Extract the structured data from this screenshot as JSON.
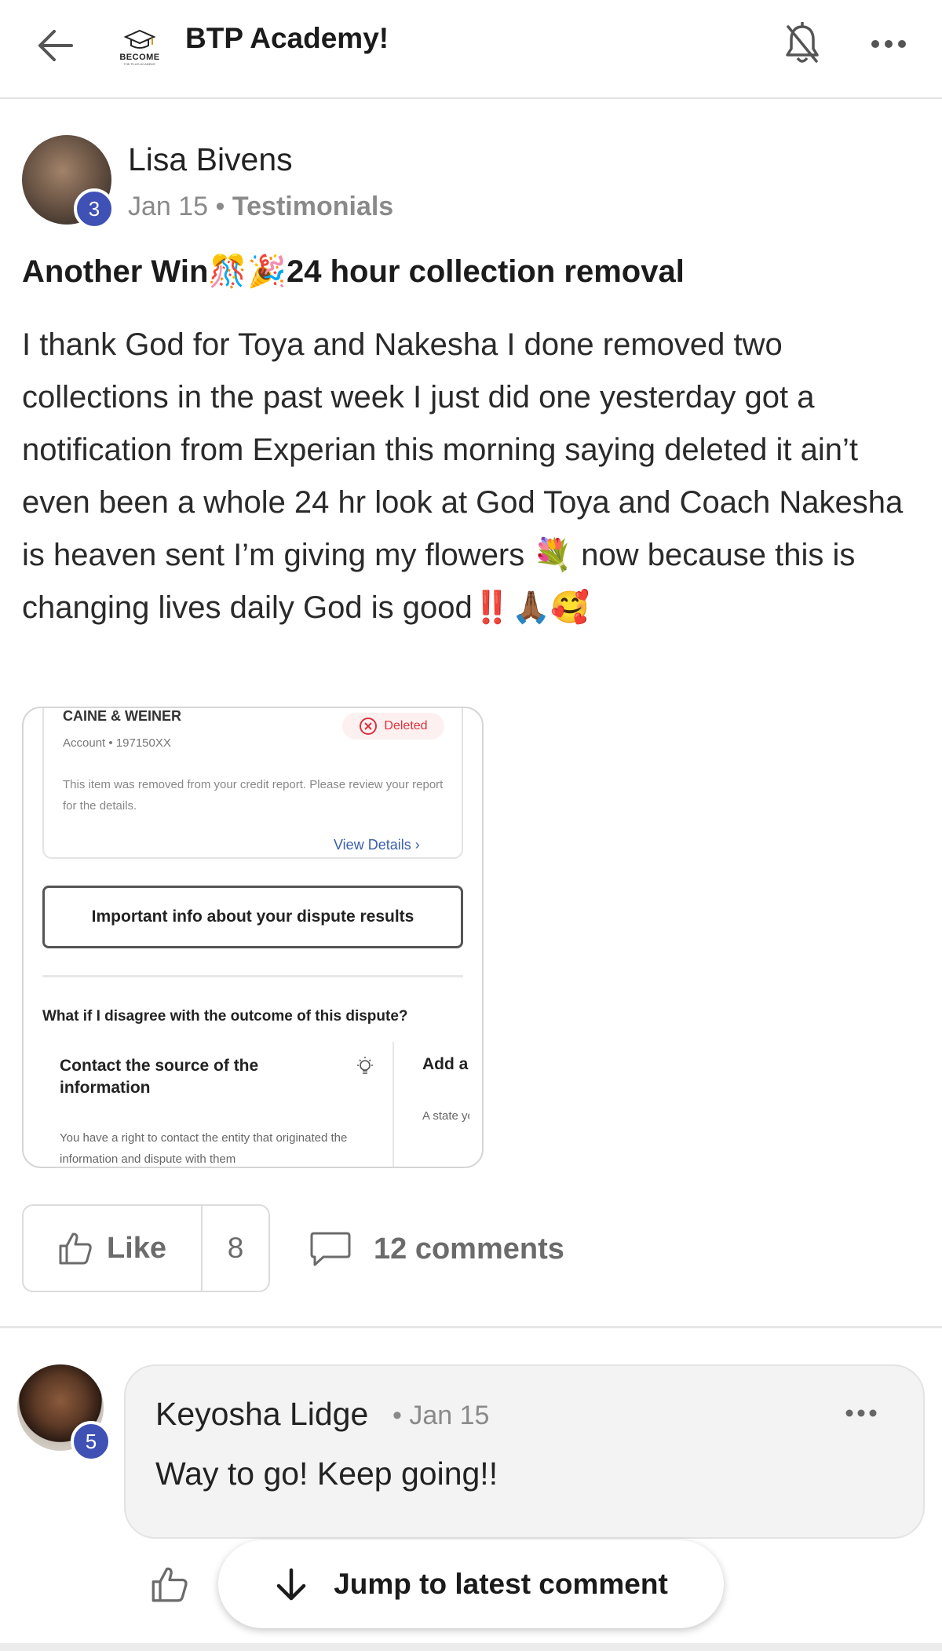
{
  "header": {
    "back_icon": "arrow-left-icon",
    "logo_word": "BECOME",
    "logo_sub": "THE PLUG ACADEMY",
    "title": "BTP Academy!",
    "bell_icon": "bell-off-icon",
    "more_icon": "more-horizontal-icon"
  },
  "post": {
    "author": "Lisa Bivens",
    "level": "3",
    "date": "Jan 15",
    "separator": "•",
    "category": "Testimonials",
    "title": "Another Win🎊🎉24 hour collection removal",
    "body": "I thank God for Toya and Nakesha I done removed two collections in the past week I just did one yesterday got a notification from Experian this morning saying deleted it ain’t even been a whole 24 hr look at God Toya and Coach Nakesha is heaven sent I’m giving my flowers 💐 now because this is changing lives daily God is good‼️🙏🏾🥰",
    "attachment": {
      "account_name": "CAINE & WEINER",
      "account_number": "Account • 197150XX",
      "status": "Deleted",
      "note": "This item was removed from your credit report. Please review your report for the details.",
      "view_details": "View Details",
      "info_button": "Important info about your dispute results",
      "disagree_heading": "What if I disagree with the outcome of this dispute?",
      "card1_title": "Contact the source of the information",
      "card1_text": "You have a right to contact the entity that originated the information and dispute with them",
      "card2_title": "Add a",
      "card2_text": "A state you thi incomp"
    },
    "actions": {
      "like_label": "Like",
      "like_count": "8",
      "comments_label": "12 comments",
      "like_icon": "thumbs-up-icon",
      "comment_icon": "comment-bubble-icon"
    }
  },
  "comment": {
    "author": "Keyosha Lidge",
    "level": "5",
    "date": "• Jan 15",
    "text": "Way to go! Keep going!!",
    "more_icon": "more-horizontal-icon"
  },
  "jump": {
    "label": "Jump to latest comment",
    "icon": "arrow-down-icon"
  },
  "colors": {
    "level_badge": "#3f51b5",
    "deleted_red": "#d9333f",
    "link_blue": "#3a5fa8"
  }
}
